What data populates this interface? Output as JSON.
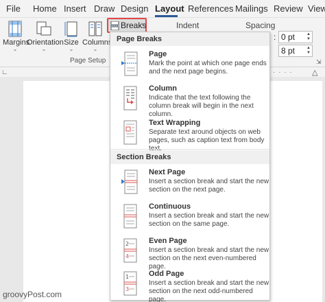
{
  "tabs": [
    {
      "label": "File"
    },
    {
      "label": "Home"
    },
    {
      "label": "Insert"
    },
    {
      "label": "Draw"
    },
    {
      "label": "Design"
    },
    {
      "label": "Layout"
    },
    {
      "label": "References"
    },
    {
      "label": "Mailings"
    },
    {
      "label": "Review"
    },
    {
      "label": "View"
    }
  ],
  "active_tab": "Layout",
  "ribbon": {
    "margins_label": "Margins",
    "orientation_label": "Orientation",
    "size_label": "Size",
    "columns_label": "Columns",
    "breaks_label": "Breaks",
    "group_label": "Page Setup",
    "indent_label": "Indent",
    "spacing_label": "Spacing",
    "spacing_before": "0 pt",
    "spacing_after": "8 pt"
  },
  "menu": {
    "page_breaks_header": "Page Breaks",
    "section_breaks_header": "Section Breaks",
    "page_breaks": [
      {
        "title": "Page",
        "desc": "Mark the point at which one page ends and the next page begins.",
        "icon": "page-break-icon"
      },
      {
        "title": "Column",
        "desc": "Indicate that the text following the column break will begin in the next column.",
        "icon": "column-break-icon"
      },
      {
        "title": "Text Wrapping",
        "desc": "Separate text around objects on web pages, such as caption text from body text.",
        "icon": "text-wrapping-icon"
      }
    ],
    "section_breaks": [
      {
        "title": "Next Page",
        "desc": "Insert a section break and start the new section on the next page.",
        "icon": "next-page-icon"
      },
      {
        "title": "Continuous",
        "desc": "Insert a section break and start the new section on the same page.",
        "icon": "continuous-icon"
      },
      {
        "title": "Even Page",
        "desc": "Insert a section break and start the new section on the next even-numbered page.",
        "icon": "even-page-icon"
      },
      {
        "title": "Odd Page",
        "desc": "Insert a section break and start the new section on the next odd-numbered page.",
        "icon": "odd-page-icon"
      }
    ]
  },
  "watermark": "groovyPost.com",
  "colors": {
    "accent": "#2b579a",
    "highlight": "#e04747",
    "icon_blue": "#2e7bcf",
    "icon_red": "#d9534f"
  }
}
